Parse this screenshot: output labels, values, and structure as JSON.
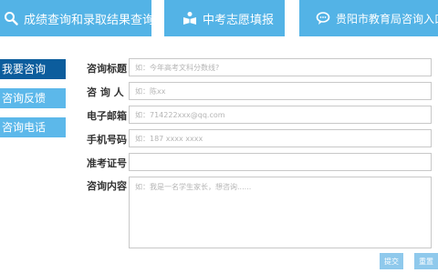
{
  "topnav": {
    "tabs": [
      {
        "label": "成绩查询和录取结果查询",
        "icon": "search-icon"
      },
      {
        "label": "中考志愿填报",
        "icon": "book-reader-icon"
      },
      {
        "label": "贵阳市教育局咨询入口",
        "icon": "chat-bubble-icon"
      }
    ]
  },
  "sidebar": {
    "items": [
      {
        "label": "我要咨询",
        "active": true
      },
      {
        "label": "咨询反馈",
        "active": false
      },
      {
        "label": "咨询电话",
        "active": false
      }
    ]
  },
  "form": {
    "title": {
      "label": "咨询标题",
      "placeholder": "如：今年高考文科分数线?"
    },
    "name": {
      "label": "咨 询 人",
      "placeholder": "如：陈xx"
    },
    "email": {
      "label": "电子邮箱",
      "placeholder": "如：714222xxx@qq.com"
    },
    "phone": {
      "label": "手机号码",
      "placeholder": "如：187 xxxx xxxx"
    },
    "id_number": {
      "label": "准考证号",
      "placeholder": ""
    },
    "content": {
      "label": "咨询内容",
      "placeholder": "如：我是一名学生家长，想咨询......"
    }
  },
  "buttons": {
    "submit": "提交",
    "reset": "重置"
  },
  "colors": {
    "tab_bg": "#53b3e6",
    "sidebar_active": "#0c5d9d",
    "sidebar_normal": "#5cb8ea",
    "button_bg": "#8fc9ec"
  }
}
